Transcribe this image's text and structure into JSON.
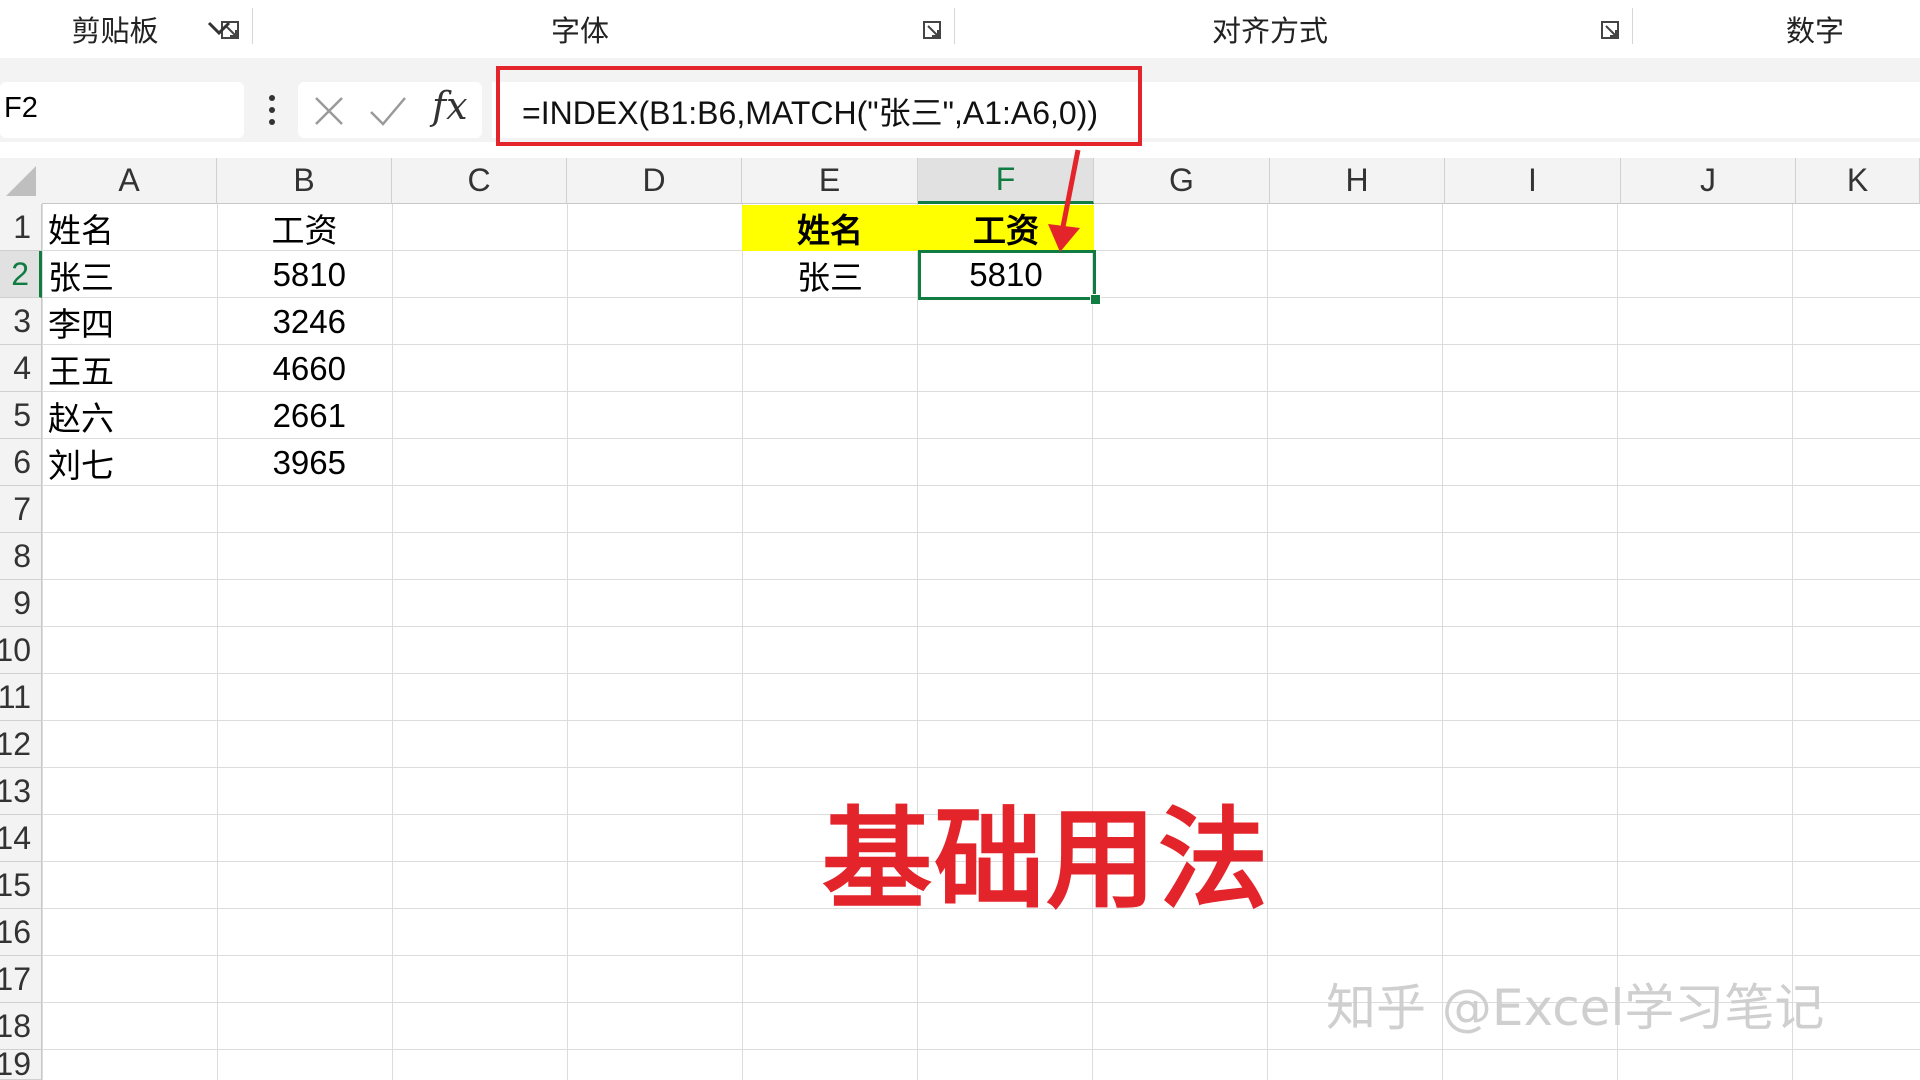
{
  "ribbon": {
    "groups": [
      {
        "label": "剪贴板"
      },
      {
        "label": "字体"
      },
      {
        "label": "对齐方式"
      },
      {
        "label": "数字"
      }
    ]
  },
  "formula_bar": {
    "name_box": "F2",
    "fx_label": "fx",
    "formula": "=INDEX(B1:B6,MATCH(\"张三\",A1:A6,0))"
  },
  "grid": {
    "columns": [
      "A",
      "B",
      "C",
      "D",
      "E",
      "F",
      "G",
      "H",
      "I",
      "J",
      "K"
    ],
    "selected_column": "F",
    "rows": [
      "1",
      "2",
      "3",
      "4",
      "5",
      "6",
      "7",
      "8",
      "9",
      "10",
      "11",
      "12",
      "13",
      "14",
      "15",
      "16",
      "17",
      "18",
      "19"
    ],
    "selected_row": "2",
    "table_a": {
      "header_name": "姓名",
      "header_salary": "工资",
      "records": [
        {
          "name": "张三",
          "salary": "5810"
        },
        {
          "name": "李四",
          "salary": "3246"
        },
        {
          "name": "王五",
          "salary": "4660"
        },
        {
          "name": "赵六",
          "salary": "2661"
        },
        {
          "name": "刘七",
          "salary": "3965"
        }
      ]
    },
    "lookup": {
      "header_name": "姓名",
      "header_salary": "工资",
      "name": "张三",
      "result": "5810"
    }
  },
  "colors": {
    "accent_green": "#107c41",
    "highlight_red": "#e3242b",
    "header_yellow": "#ffff00"
  },
  "caption": "基础用法",
  "watermark": "知乎 @Excel学习笔记"
}
